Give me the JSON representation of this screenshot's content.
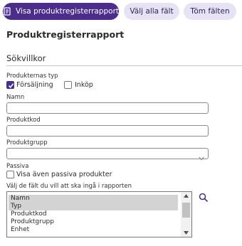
{
  "toolbar": {
    "primary_label": "Visa produktregisterrapport",
    "select_all_label": "Välj alla fält",
    "clear_label": "Töm fälten"
  },
  "page_title": "Produktregisterrapport",
  "section_title": "Sökvillkor",
  "product_types": {
    "label": "Produkternas typ",
    "sales_label": "Försäljning",
    "sales_checked": true,
    "purchase_label": "Inköp",
    "purchase_checked": false
  },
  "fields": {
    "name_label": "Namn",
    "name_value": "",
    "code_label": "Produktkod",
    "code_value": "",
    "group_label": "Produktgrupp",
    "group_value": ""
  },
  "passive": {
    "label": "Passiva",
    "checkbox_label": "Visa även passiva produkter",
    "checked": false
  },
  "report_fields": {
    "label": "Välj de fält du vill att ska ingå i rapporten",
    "items": [
      {
        "label": "Namn",
        "selected": true
      },
      {
        "label": "Typ",
        "selected": true
      },
      {
        "label": "Produktkod",
        "selected": false
      },
      {
        "label": "Produktgrupp",
        "selected": false
      },
      {
        "label": "Enhet",
        "selected": false
      }
    ]
  },
  "icons": {
    "report": "report-icon",
    "search": "search-icon",
    "dropdown": "chevron-down-icon"
  },
  "colors": {
    "primary": "#4b2e8c",
    "secondary_bg": "#e8e3f4"
  }
}
